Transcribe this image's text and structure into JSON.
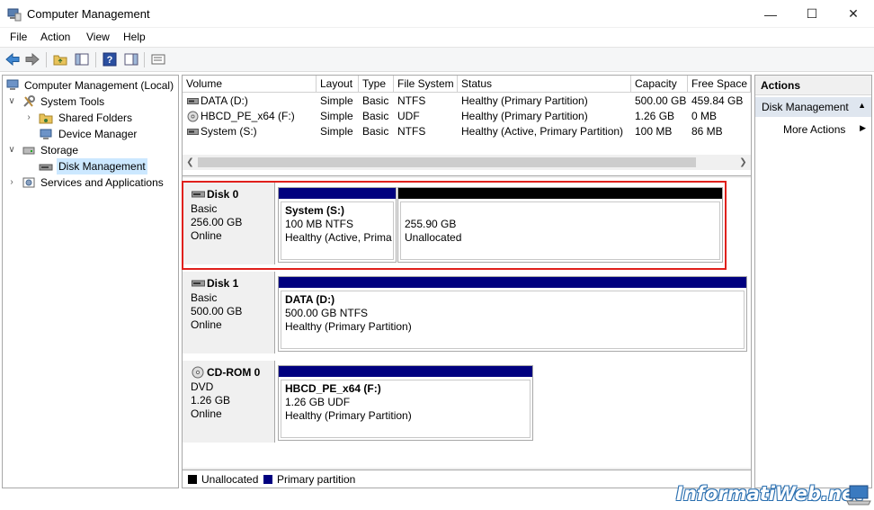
{
  "window": {
    "title": "Computer Management",
    "minimize": "—",
    "maximize": "☐",
    "close": "✕"
  },
  "menu": [
    "File",
    "Action",
    "View",
    "Help"
  ],
  "tree": {
    "root": "Computer Management (Local)",
    "system_tools": "System Tools",
    "shared_folders": "Shared Folders",
    "device_manager": "Device Manager",
    "storage": "Storage",
    "disk_management": "Disk Management",
    "services": "Services and Applications"
  },
  "volumes": {
    "columns": [
      "Volume",
      "Layout",
      "Type",
      "File System",
      "Status",
      "Capacity",
      "Free Space"
    ],
    "rows": [
      [
        "DATA (D:)",
        "Simple",
        "Basic",
        "NTFS",
        "Healthy (Primary Partition)",
        "500.00 GB",
        "459.84 GB"
      ],
      [
        "HBCD_PE_x64 (F:)",
        "Simple",
        "Basic",
        "UDF",
        "Healthy (Primary Partition)",
        "1.26 GB",
        "0 MB"
      ],
      [
        "System (S:)",
        "Simple",
        "Basic",
        "NTFS",
        "Healthy (Active, Primary Partition)",
        "100 MB",
        "86 MB"
      ]
    ]
  },
  "disks": {
    "disk0": {
      "name": "Disk 0",
      "kind": "Basic",
      "size": "256.00 GB",
      "state": "Online",
      "p1": {
        "title": "System  (S:)",
        "line2": "100 MB NTFS",
        "line3": "Healthy (Active, Prima"
      },
      "p2": {
        "title": "",
        "line2": "255.90 GB",
        "line3": "Unallocated"
      }
    },
    "disk1": {
      "name": "Disk 1",
      "kind": "Basic",
      "size": "500.00 GB",
      "state": "Online",
      "p1": {
        "title": "DATA  (D:)",
        "line2": "500.00 GB NTFS",
        "line3": "Healthy (Primary Partition)"
      }
    },
    "cdrom0": {
      "name": "CD-ROM 0",
      "kind": "DVD",
      "size": "1.26 GB",
      "state": "Online",
      "p1": {
        "title": "HBCD_PE_x64  (F:)",
        "line2": "1.26 GB UDF",
        "line3": "Healthy (Primary Partition)"
      }
    }
  },
  "legend": {
    "unallocated": "Unallocated",
    "primary": "Primary partition"
  },
  "actions": {
    "header": "Actions",
    "section": "Disk Management",
    "more": "More Actions"
  },
  "colors": {
    "primary_bar": "#00007f",
    "unallocated_bar": "#000000",
    "highlight": "#e0201c"
  },
  "watermark": "InformatiWeb.net"
}
